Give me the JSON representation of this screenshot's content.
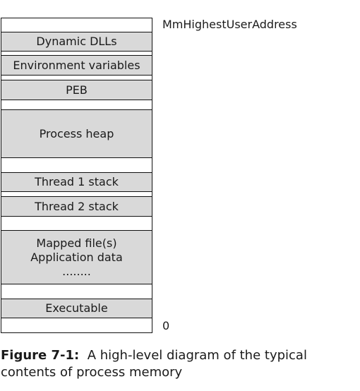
{
  "diagram": {
    "top_address_label": "MmHighestUserAddress",
    "bottom_address_label": "0",
    "segments": [
      {
        "type": "empty",
        "lines": []
      },
      {
        "type": "filled",
        "lines": [
          "Dynamic DLLs"
        ]
      },
      {
        "type": "empty",
        "lines": []
      },
      {
        "type": "filled",
        "lines": [
          "Environment variables"
        ]
      },
      {
        "type": "empty",
        "lines": []
      },
      {
        "type": "filled",
        "lines": [
          "PEB"
        ]
      },
      {
        "type": "empty",
        "lines": []
      },
      {
        "type": "filled",
        "lines": [
          "Process heap"
        ]
      },
      {
        "type": "empty",
        "lines": []
      },
      {
        "type": "filled",
        "lines": [
          "Thread 1 stack"
        ]
      },
      {
        "type": "empty",
        "lines": []
      },
      {
        "type": "filled",
        "lines": [
          "Thread 2 stack"
        ]
      },
      {
        "type": "empty",
        "lines": []
      },
      {
        "type": "filled",
        "lines": [
          "Mapped file(s)",
          "Application data",
          "........"
        ]
      },
      {
        "type": "empty",
        "lines": []
      },
      {
        "type": "filled",
        "lines": [
          "Executable"
        ]
      },
      {
        "type": "empty",
        "lines": []
      }
    ]
  },
  "caption": {
    "label": "Figure 7-1:",
    "text": "A high-level diagram of the typical",
    "text_line2": "contents of process memory"
  }
}
